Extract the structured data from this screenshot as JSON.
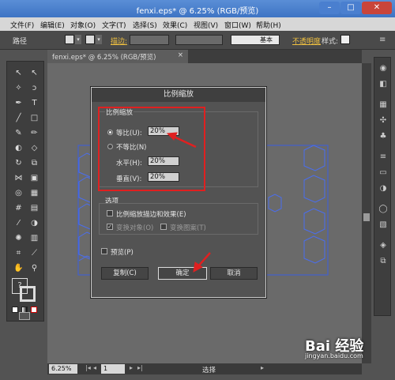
{
  "window": {
    "title": "fenxi.eps* @ 6.25% (RGB/预览)",
    "minimize": "–",
    "maximize": "□",
    "close": "✕"
  },
  "menu": [
    "文件(F)",
    "编辑(E)",
    "对象(O)",
    "文字(T)",
    "选择(S)",
    "效果(C)",
    "视图(V)",
    "窗口(W)",
    "帮助(H)"
  ],
  "control_bar": {
    "label": "路径",
    "stroke_label": "描边:",
    "stroke_style": "基本",
    "opacity_label": "不透明度",
    "style_label": "样式:"
  },
  "doc_tab": {
    "label": "fenxi.eps* @ 6.25% (RGB/预览)",
    "close": "×"
  },
  "dialog": {
    "title": "比例缩放",
    "scale_group": "比例缩放",
    "uniform_label": "等比(U):",
    "uniform_value": "20%",
    "nonuniform_label": "不等比(N)",
    "horizontal_label": "水平(H):",
    "horizontal_value": "20%",
    "vertical_label": "垂直(V):",
    "vertical_value": "20%",
    "options_group": "选项",
    "scale_strokes_label": "比例缩放描边和效果(E)",
    "transform_objects_label": "变换对象(O)",
    "transform_patterns_label": "变换图案(T)",
    "preview_label": "预览(P)",
    "copy_button": "复制(C)",
    "ok_button": "确定",
    "cancel_button": "取消"
  },
  "status": {
    "zoom": "6.25%",
    "page": "1",
    "mode": "选择"
  },
  "watermark": {
    "brand": "Bai 经验",
    "url": "jingyan.baidu.com"
  }
}
